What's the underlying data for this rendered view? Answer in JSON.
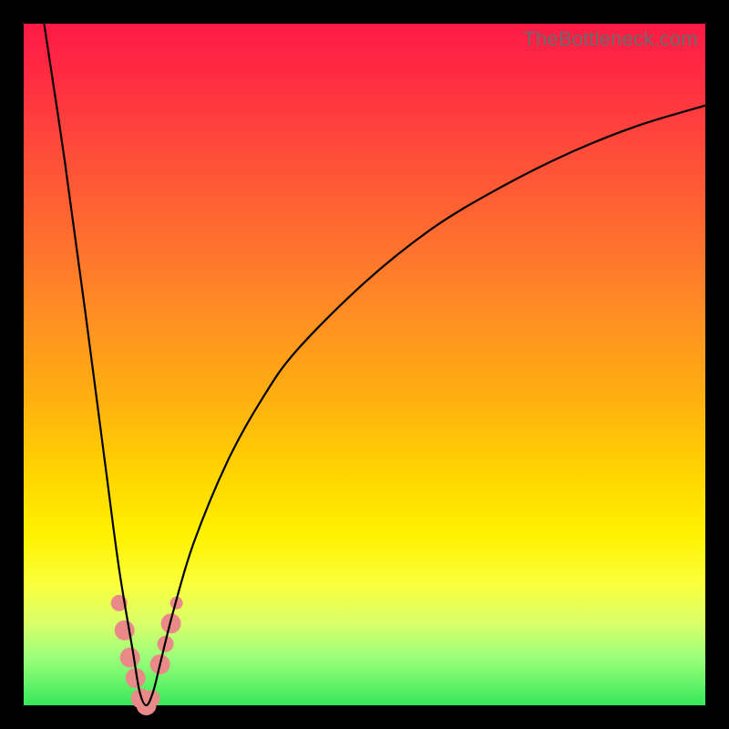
{
  "watermark": "TheBottleneck.com",
  "colors": {
    "frame": "#000000",
    "curve": "#000000",
    "marker": "#e98a88",
    "gradient_top": "#ff1a45",
    "gradient_mid": "#ffd400",
    "gradient_bottom": "#36e85a"
  },
  "chart_data": {
    "type": "line",
    "title": "",
    "xlabel": "",
    "ylabel": "",
    "xlim": [
      0,
      100
    ],
    "ylim": [
      0,
      100
    ],
    "notes": "V-shaped bottleneck curve. Y represents bottleneck percentage (0 at bottom/green, 100 at top/red). X is an unlabeled component ratio. Curve reaches 0 near x≈18 then asymptotically rises toward ~88 on the right.",
    "series": [
      {
        "name": "bottleneck-curve",
        "x": [
          3,
          6,
          9,
          12,
          14,
          16,
          17,
          18,
          19,
          20,
          22,
          25,
          30,
          35,
          40,
          50,
          60,
          70,
          80,
          90,
          100
        ],
        "y": [
          100,
          80,
          58,
          35,
          20,
          8,
          2,
          0,
          2,
          6,
          14,
          24,
          36,
          45,
          52,
          62,
          70,
          76,
          81,
          85,
          88
        ]
      }
    ],
    "markers": {
      "name": "highlighted-range",
      "note": "Salmon dots clustered around the minimum (x≈14–22, y≈0–15)",
      "points": [
        {
          "x": 14.0,
          "y": 15,
          "size": "md"
        },
        {
          "x": 14.8,
          "y": 11,
          "size": "lg"
        },
        {
          "x": 15.6,
          "y": 7,
          "size": "lg"
        },
        {
          "x": 16.4,
          "y": 4,
          "size": "lg"
        },
        {
          "x": 17.2,
          "y": 1,
          "size": "lg"
        },
        {
          "x": 18.0,
          "y": 0,
          "size": "lg"
        },
        {
          "x": 18.8,
          "y": 1,
          "size": "md"
        },
        {
          "x": 20.0,
          "y": 6,
          "size": "lg"
        },
        {
          "x": 20.8,
          "y": 9,
          "size": "md"
        },
        {
          "x": 21.6,
          "y": 12,
          "size": "lg"
        },
        {
          "x": 22.4,
          "y": 15,
          "size": "sm"
        }
      ]
    }
  }
}
